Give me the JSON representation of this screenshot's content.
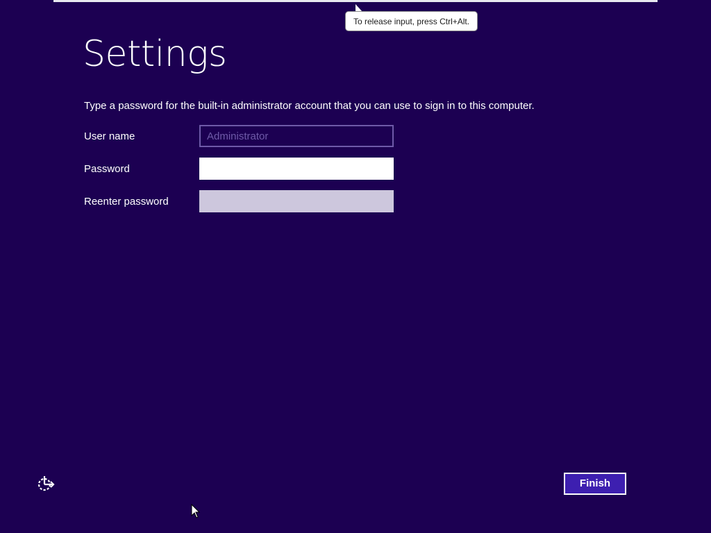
{
  "tooltip": {
    "text": "To release input, press Ctrl+Alt."
  },
  "page": {
    "title": "Settings",
    "description": "Type a password for the built-in administrator account that you can use to sign in to this computer."
  },
  "form": {
    "username": {
      "label": "User name",
      "value": "Administrator"
    },
    "password": {
      "label": "Password",
      "value": ""
    },
    "reenter": {
      "label": "Reenter password",
      "value": ""
    }
  },
  "footer": {
    "finish_label": "Finish",
    "ease_of_access_icon": "ease-of-access-icon"
  },
  "colors": {
    "background": "#1c0052",
    "accent_button": "#3d1fb0",
    "disabled_field_border": "#6e5aa8",
    "reenter_field_fill": "#cdc7dd"
  }
}
